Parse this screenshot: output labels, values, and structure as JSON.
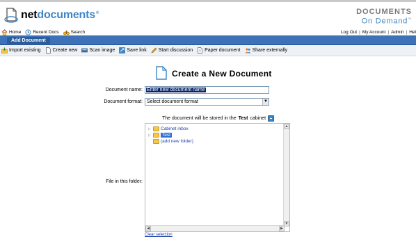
{
  "header": {
    "logo_net": "net",
    "logo_documents": "documents",
    "logo_mark": "®",
    "brand_line1": "DOCUMENTS",
    "brand_line2": "On Demand",
    "brand_tm": "™"
  },
  "topnav": {
    "home": "Home",
    "recent_docs": "Recent Docs",
    "search": "Search"
  },
  "usernav": {
    "logout": "Log Out",
    "my_account": "My Account",
    "admin": "Admin",
    "help": "Hel",
    "separator": "|"
  },
  "tab": {
    "label": "Add Document"
  },
  "toolbar": {
    "import_existing": "Import existing",
    "create_new": "Create new",
    "scan_image": "Scan image",
    "save_link": "Save link",
    "start_discussion": "Start discussion",
    "paper_document": "Paper document",
    "share_externally": "Share externally"
  },
  "form": {
    "title": "Create a New Document",
    "name_label": "Document name:",
    "name_value": "Enter new document name",
    "format_label": "Document format:",
    "format_value": "Select document format",
    "storage_prefix": "The document will be stored in the",
    "storage_cabinet": "Test",
    "storage_suffix": "cabinet",
    "folder_label": "File in this folder:",
    "clear_selection": "Clear selection"
  },
  "tree": {
    "items": [
      {
        "label": "Cabinet inbox",
        "expandable": true,
        "selected": false
      },
      {
        "label": "Test",
        "expandable": true,
        "selected": true
      },
      {
        "label": "(add new folder)",
        "expandable": false,
        "selected": false
      }
    ]
  },
  "colors": {
    "accent": "#3f87c4",
    "tabstrip": "#3d72b8",
    "link": "#1a3fa8"
  }
}
